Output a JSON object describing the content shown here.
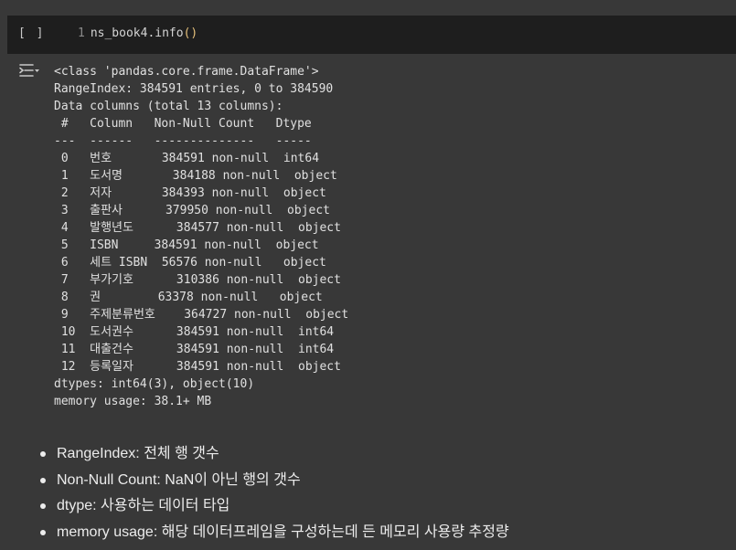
{
  "code_cell": {
    "run_indicator": "[ ]",
    "line_number": "1",
    "code_prefix": "ns_book4.info",
    "code_paren": "()"
  },
  "output": {
    "icon": "output-options-icon",
    "lines": [
      "<class 'pandas.core.frame.DataFrame'>",
      "RangeIndex: 384591 entries, 0 to 384590",
      "Data columns (total 13 columns):",
      " #   Column   Non-Null Count   Dtype ",
      "---  ------   --------------   ----- ",
      " 0   번호       384591 non-null  int64 ",
      " 1   도서명       384188 non-null  object",
      " 2   저자       384393 non-null  object",
      " 3   출판사      379950 non-null  object",
      " 4   발행년도      384577 non-null  object",
      " 5   ISBN     384591 non-null  object",
      " 6   세트 ISBN  56576 non-null   object",
      " 7   부가기호      310386 non-null  object",
      " 8   권        63378 non-null   object",
      " 9   주제분류번호    364727 non-null  object",
      " 10  도서권수      384591 non-null  int64 ",
      " 11  대출건수      384591 non-null  int64 ",
      " 12  등록일자      384591 non-null  object",
      "dtypes: int64(3), object(10)",
      "memory usage: 38.1+ MB"
    ]
  },
  "notes": [
    {
      "term": "RangeIndex",
      "desc": ": 전체 행 갯수"
    },
    {
      "term": "Non-Null Count",
      "desc": ": NaN이 아닌 행의 갯수"
    },
    {
      "term": "dtype",
      "desc": ": 사용하는 데이터 타입"
    },
    {
      "term": "memory usage",
      "desc": ": 해당 데이터프레임을 구성하는데 든 메모리 사용량 추정량"
    }
  ]
}
